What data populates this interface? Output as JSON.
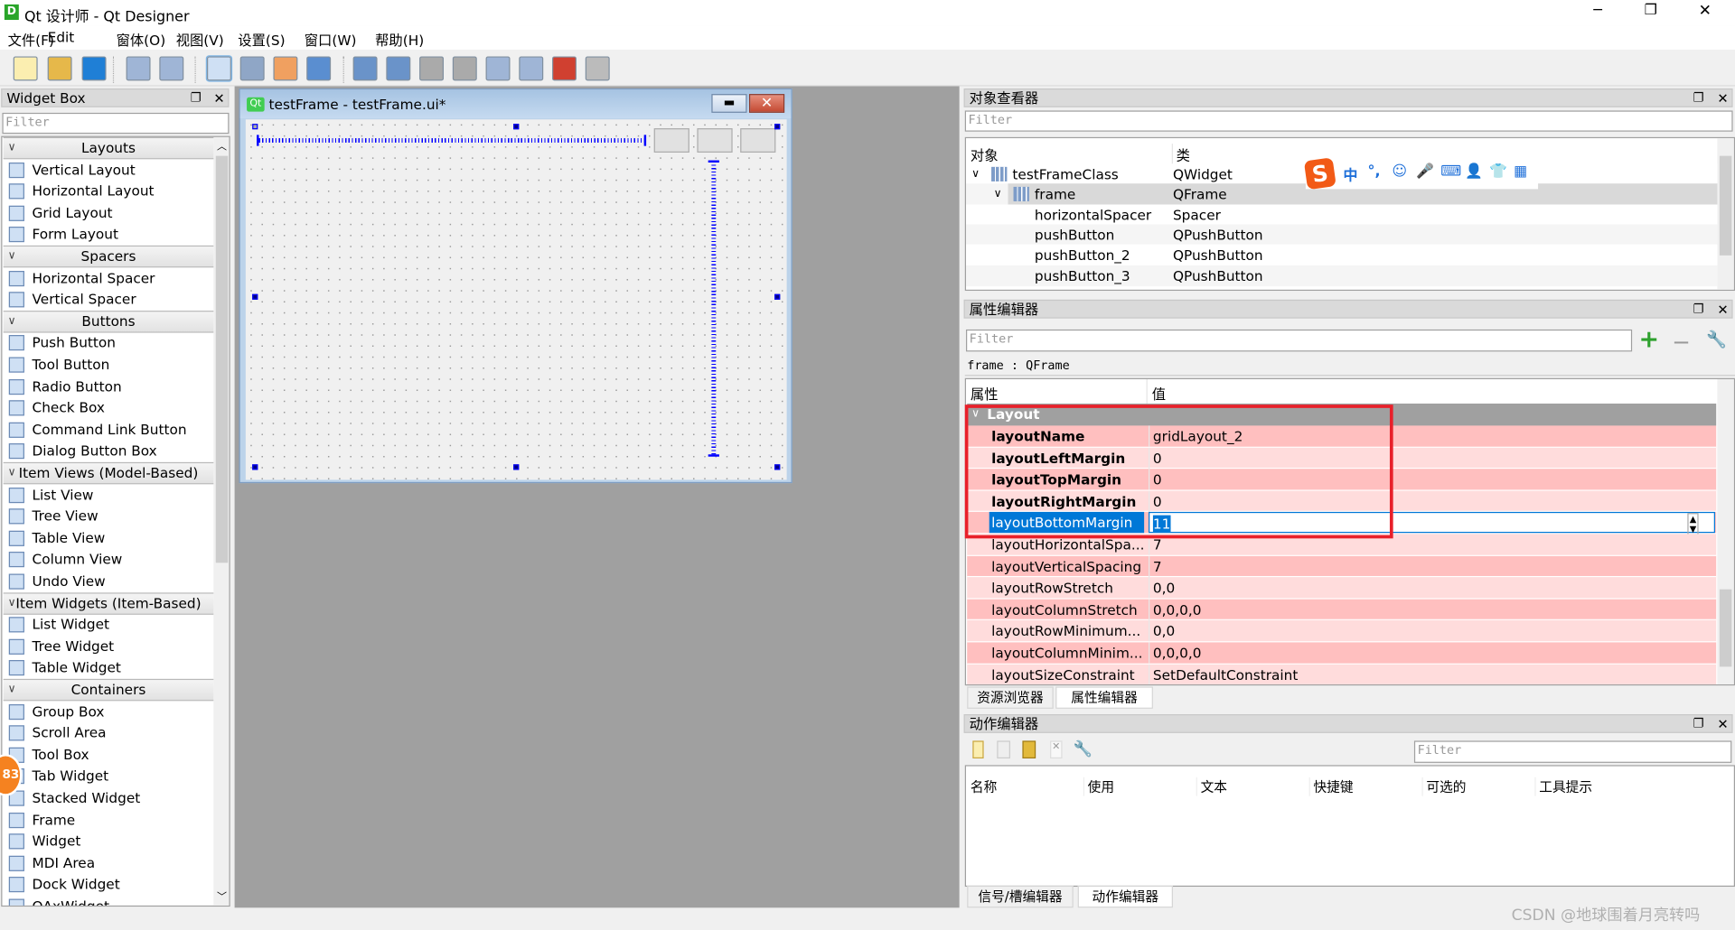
{
  "window": {
    "title": "Qt 设计师 - Qt Designer",
    "minimize": "─",
    "maximize": "❐",
    "close": "✕",
    "app_icon": "D"
  },
  "menu": [
    "文件(F)",
    "Edit",
    "窗体(O)",
    "视图(V)",
    "设置(S)",
    "窗口(W)",
    "帮助(H)"
  ],
  "toolbar": [
    "new-file-icon",
    "open-folder-icon",
    "save-icon",
    "send-to-back-icon",
    "bring-to-front-icon",
    "edit-widgets-icon",
    "edit-signals-slots-icon",
    "edit-buddies-icon",
    "edit-tab-order-icon",
    "layout-horizontal-icon",
    "layout-vertical-icon",
    "layout-horizontal-splitter-icon",
    "layout-vertical-splitter-icon",
    "layout-grid-icon",
    "layout-form-icon",
    "break-layout-icon",
    "adjust-size-icon"
  ],
  "widget_box": {
    "title": "Widget Box",
    "filter_placeholder": "Filter",
    "float_icon": "❐",
    "close_icon": "✕",
    "sections": [
      {
        "name": "Layouts",
        "items": [
          "Vertical Layout",
          "Horizontal Layout",
          "Grid Layout",
          "Form Layout"
        ]
      },
      {
        "name": "Spacers",
        "items": [
          "Horizontal Spacer",
          "Vertical Spacer"
        ]
      },
      {
        "name": "Buttons",
        "items": [
          "Push Button",
          "Tool Button",
          "Radio Button",
          "Check Box",
          "Command Link Button",
          "Dialog Button Box"
        ]
      },
      {
        "name": "Item Views (Model-Based)",
        "items": [
          "List View",
          "Tree View",
          "Table View",
          "Column View",
          "Undo View"
        ]
      },
      {
        "name": "Item Widgets (Item-Based)",
        "items": [
          "List Widget",
          "Tree Widget",
          "Table Widget"
        ]
      },
      {
        "name": "Containers",
        "items": [
          "Group Box",
          "Scroll Area",
          "Tool Box",
          "Tab Widget",
          "Stacked Widget",
          "Frame",
          "Widget",
          "MDI Area",
          "Dock Widget",
          "QAxWidget"
        ]
      }
    ]
  },
  "badge": "83",
  "form_window": {
    "title": "testFrame - testFrame.ui*",
    "icon": "Qt"
  },
  "object_inspector": {
    "title": "对象查看器",
    "filter_placeholder": "Filter",
    "columns": [
      "对象",
      "类"
    ],
    "rows": [
      {
        "object": "testFrameClass",
        "class": "QWidget",
        "level": 0,
        "expanded": true
      },
      {
        "object": "frame",
        "class": "QFrame",
        "level": 1,
        "expanded": true,
        "selected": true
      },
      {
        "object": "horizontalSpacer",
        "class": "Spacer",
        "level": 2
      },
      {
        "object": "pushButton",
        "class": "QPushButton",
        "level": 2
      },
      {
        "object": "pushButton_2",
        "class": "QPushButton",
        "level": 2
      },
      {
        "object": "pushButton_3",
        "class": "QPushButton",
        "level": 2
      }
    ]
  },
  "ime_toolbar": {
    "items": [
      "中",
      "°,",
      "☺",
      "🎤",
      "⌨",
      "👤",
      "👕",
      "▦"
    ]
  },
  "property_editor": {
    "title": "属性编辑器",
    "filter_placeholder": "Filter",
    "context": "frame : QFrame",
    "columns": [
      "属性",
      "值"
    ],
    "group": "Layout",
    "rows": [
      {
        "name": "layoutName",
        "value": "gridLayout_2",
        "bold": true
      },
      {
        "name": "layoutLeftMargin",
        "value": "0",
        "bold": true
      },
      {
        "name": "layoutTopMargin",
        "value": "0",
        "bold": true
      },
      {
        "name": "layoutRightMargin",
        "value": "0",
        "bold": true
      },
      {
        "name": "layoutBottomMargin",
        "value": "11",
        "bold": false,
        "editing": true
      },
      {
        "name": "layoutHorizontalSpa...",
        "value": "7"
      },
      {
        "name": "layoutVerticalSpacing",
        "value": "7"
      },
      {
        "name": "layoutRowStretch",
        "value": "0,0"
      },
      {
        "name": "layoutColumnStretch",
        "value": "0,0,0,0"
      },
      {
        "name": "layoutRowMinimum...",
        "value": "0,0"
      },
      {
        "name": "layoutColumnMinim...",
        "value": "0,0,0,0"
      },
      {
        "name": "layoutSizeConstraint",
        "value": "SetDefaultConstraint"
      }
    ],
    "tabs": [
      "资源浏览器",
      "属性编辑器"
    ],
    "active_tab": 1
  },
  "action_editor": {
    "title": "动作编辑器",
    "filter_placeholder": "Filter",
    "columns": [
      "名称",
      "使用",
      "文本",
      "快捷键",
      "可选的",
      "工具提示"
    ],
    "tabs": [
      "信号/槽编辑器",
      "动作编辑器"
    ],
    "active_tab": 1
  },
  "colors": {
    "row_dark": "#ffbfbf",
    "row_light": "#ffdcdc",
    "highlight": "#0078d7",
    "annotation": "#e8202a"
  },
  "watermark": "CSDN @地球围着月亮转吗"
}
